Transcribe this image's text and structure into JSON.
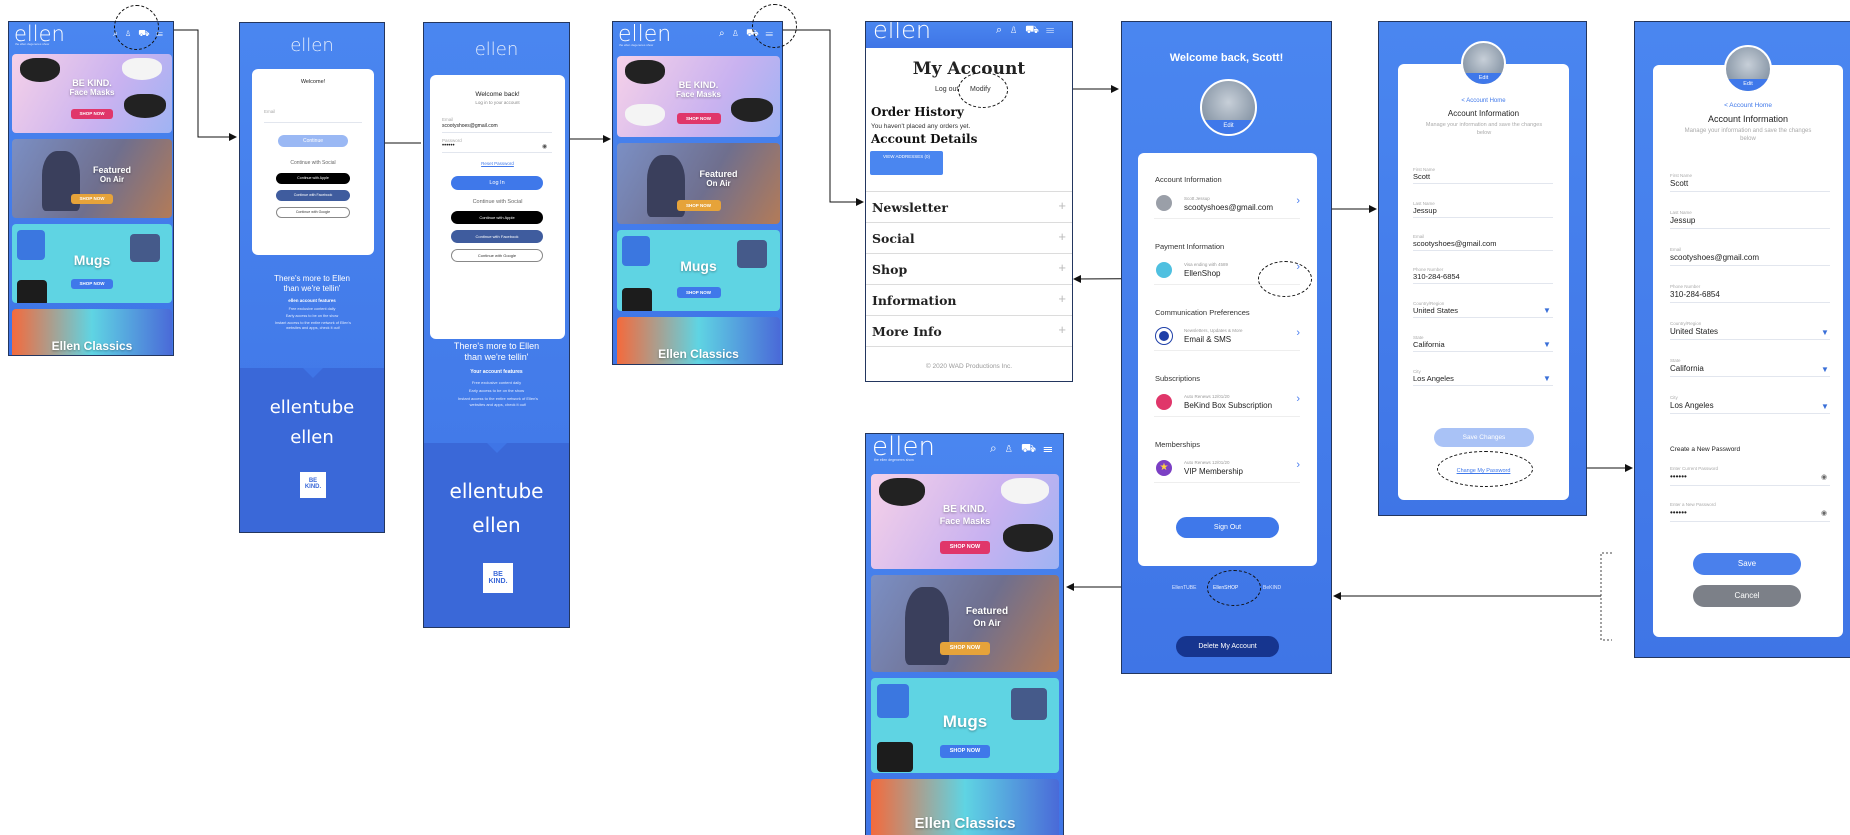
{
  "brand": {
    "logo": "ellen",
    "tagline": "the ellen degeneres show",
    "accent": "#3f78ea",
    "dark": "#23365f",
    "pink": "#e0366a"
  },
  "header_icons": "⌕ ♙ ⛟ ☰",
  "shop_tiles": [
    {
      "title": "BE KIND.",
      "title2": "Face Masks",
      "cta": "SHOP NOW"
    },
    {
      "title": "Featured",
      "title2": "On Air",
      "cta": "SHOP NOW"
    },
    {
      "title": "Mugs",
      "title2": "",
      "cta": "SHOP NOW"
    },
    {
      "title": "Ellen Classics",
      "title2": "",
      "cta": ""
    }
  ],
  "signin": {
    "welcome": "Welcome!",
    "email_label": "Email",
    "continue": "Continue",
    "continue_social": "Continue with Social",
    "apple": "Continue with Apple",
    "facebook": "Continue with Facebook",
    "google": "Continue with Google"
  },
  "login": {
    "welcome": "Welcome back!",
    "sub": "Log in to your account",
    "email_label": "Email",
    "email": "scootyshoes@gmail.com",
    "password_label": "Password",
    "password": "••••••",
    "reset": "Reset Password",
    "login": "Log In",
    "continue_social": "Continue with Social"
  },
  "promo": {
    "line1": "There's  more to Ellen",
    "line2": "than we're tellin'",
    "features_title": "ellen account features",
    "features_title2": "Your account features",
    "feat1": "Free exclusive content daily",
    "feat2": "Early access to be on the show",
    "feat3": "Instant access to the entire network of Ellen's websites and apps, check it out!",
    "ellentube": "ellentube",
    "bekind": "BE KIND."
  },
  "my_account": {
    "title": "My Account",
    "logout": "Log out",
    "modify": "Modify",
    "order_history": "Order History",
    "no_orders": "You haven't placed any orders yet.",
    "account_details": "Account Details",
    "view_addresses": "VIEW ADDRESSES (0)",
    "sections": [
      "Newsletter",
      "Social",
      "Shop",
      "Information",
      "More Info"
    ],
    "copyright": "© 2020 WAD Productions Inc."
  },
  "dashboard": {
    "welcome": "Welcome back, Scott!",
    "edit": "Edit",
    "account_info": "Account Information",
    "account_name": "Scott Jessup",
    "account_email": "scootyshoes@gmail.com",
    "payment_info": "Payment Information",
    "visa": "Visa ending with 4589",
    "payment_shop": "EllenShop",
    "comm_prefs": "Communication Preferences",
    "comm_sub": "Newsletters, Updates & More",
    "comm_val": "Email & SMS",
    "subscriptions": "Subscriptions",
    "sub_renew": "Auto Renews 12/01/20",
    "sub_val": "BeKind Box Subscription",
    "memberships": "Memberships",
    "mem_renew": "Auto Renews 12/01/20",
    "mem_val": "VIP Membership",
    "sign_out": "Sign Out",
    "links": [
      "EllenTUBE",
      "EllenSHOP",
      "BeKIND"
    ],
    "delete": "Delete My Account"
  },
  "account_info": {
    "edit": "Edit",
    "back": "< Account Home",
    "title": "Account Information",
    "sub": "Manage your information and save the changes below",
    "first_label": "First Name",
    "first": "Scott",
    "last_label": "Last Name",
    "last": "Jessup",
    "email_label": "Email",
    "email": "scootyshoes@gmail.com",
    "phone_label": "Phone Number",
    "phone": "310-284-6854",
    "country_label": "Country/Region",
    "country": "United States",
    "state_label": "State",
    "state": "California",
    "city_label": "City",
    "city": "Los Angeles",
    "save_changes": "Save Changes",
    "change_password": "Change My Password",
    "create_pw": "Create a New Password",
    "current_pw": "Enter Current Password",
    "new_pw": "Enter a New Password",
    "pw_dots": "••••••",
    "save": "Save",
    "cancel": "Cancel"
  }
}
